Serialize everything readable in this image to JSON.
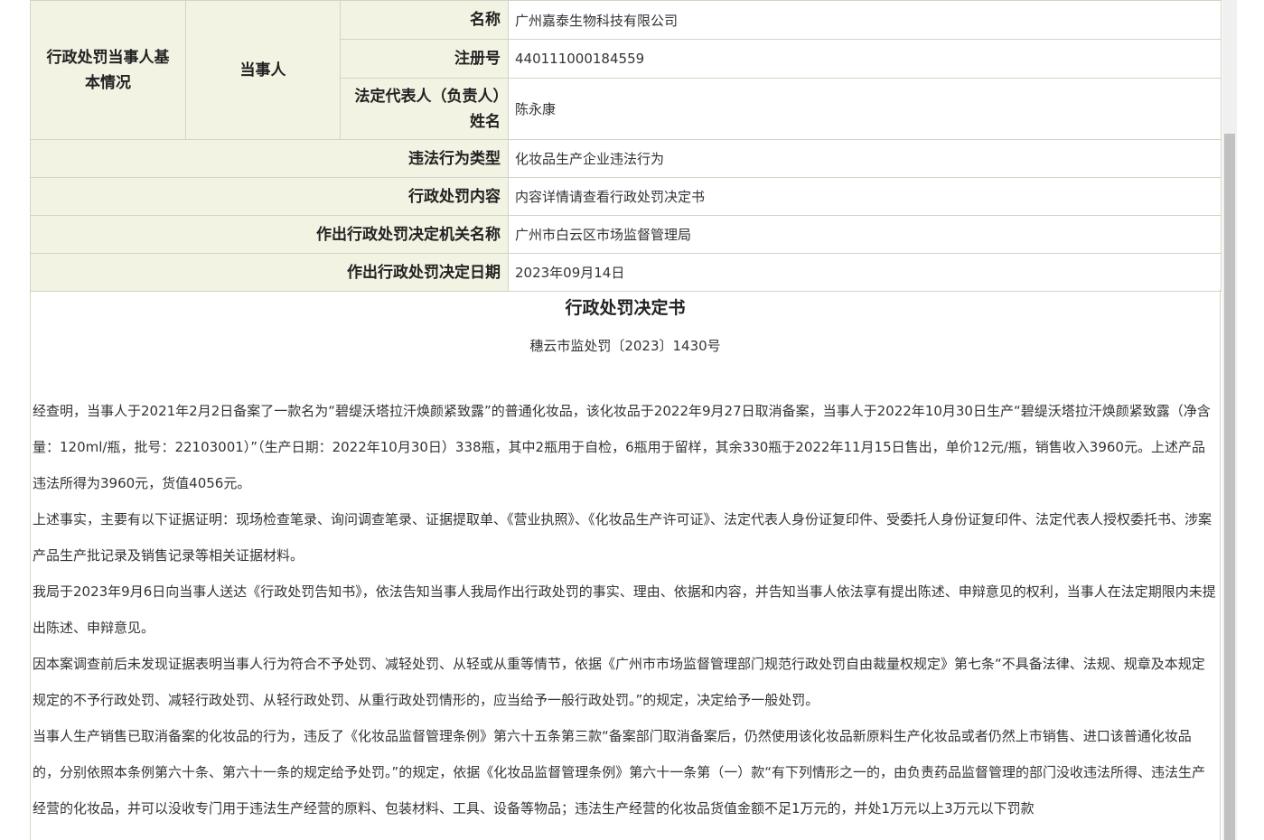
{
  "party": {
    "section_label": "行政处罚当事人基本情况",
    "party_label": "当事人",
    "name_label": "名称",
    "name_value": "广州嘉泰生物科技有限公司",
    "reg_label": "注册号",
    "reg_value": "440111000184559",
    "rep_label": "法定代表人（负责人）姓名",
    "rep_value": "陈永康"
  },
  "rows": [
    {
      "label": "违法行为类型",
      "value": "化妆品生产企业违法行为"
    },
    {
      "label": "行政处罚内容",
      "value": "内容详情请查看行政处罚决定书"
    },
    {
      "label": "作出行政处罚决定机关名称",
      "value": "广州市白云区市场监督管理局"
    },
    {
      "label": "作出行政处罚决定日期",
      "value": "2023年09月14日"
    }
  ],
  "document": {
    "title": "行政处罚决定书",
    "number": "穗云市监处罚〔2023〕1430号",
    "paragraphs": [
      "经查明，当事人于2021年2月2日备案了一款名为“碧缇沃塔拉汗焕颜紧致露”的普通化妆品，该化妆品于2022年9月27日取消备案，当事人于2022年10月30日生产“碧缇沃塔拉汗焕颜紧致露（净含量：120ml/瓶，批号：22103001）”（生产日期：2022年10月30日）338瓶，其中2瓶用于自检，6瓶用于留样，其余330瓶于2022年11月15日售出，单价12元/瓶，销售收入3960元。上述产品违法所得为3960元，货值4056元。",
      "上述事实，主要有以下证据证明：现场检查笔录、询问调查笔录、证据提取单、《营业执照》、《化妆品生产许可证》、法定代表人身份证复印件、受委托人身份证复印件、法定代表人授权委托书、涉案产品生产批记录及销售记录等相关证据材料。",
      "我局于2023年9月6日向当事人送达《行政处罚告知书》，依法告知当事人我局作出行政处罚的事实、理由、依据和内容，并告知当事人依法享有提出陈述、申辩意见的权利，当事人在法定期限内未提出陈述、申辩意见。",
      "因本案调查前后未发现证据表明当事人行为符合不予处罚、减轻处罚、从轻或从重等情节，依据《广州市市场监督管理部门规范行政处罚自由裁量权规定》第七条“不具备法律、法规、规章及本规定规定的不予行政处罚、减轻行政处罚、从轻行政处罚、从重行政处罚情形的，应当给予一般行政处罚。”的规定，决定给予一般处罚。",
      "当事人生产销售已取消备案的化妆品的行为，违反了《化妆品监督管理条例》第六十五条第三款“备案部门取消备案后，仍然使用该化妆品新原料生产化妆品或者仍然上市销售、进口该普通化妆品的，分别依照本条例第六十条、第六十一条的规定给予处罚。”的规定，依据《化妆品监督管理条例》第六十一条第（一）款“有下列情形之一的，由负责药品监督管理的部门没收违法所得、违法生产经营的化妆品，并可以没收专门用于违法生产经营的原料、包装材料、工具、设备等物品；违法生产经营的化妆品货值金额不足1万元的，并处1万元以上3万元以下罚款"
    ]
  }
}
